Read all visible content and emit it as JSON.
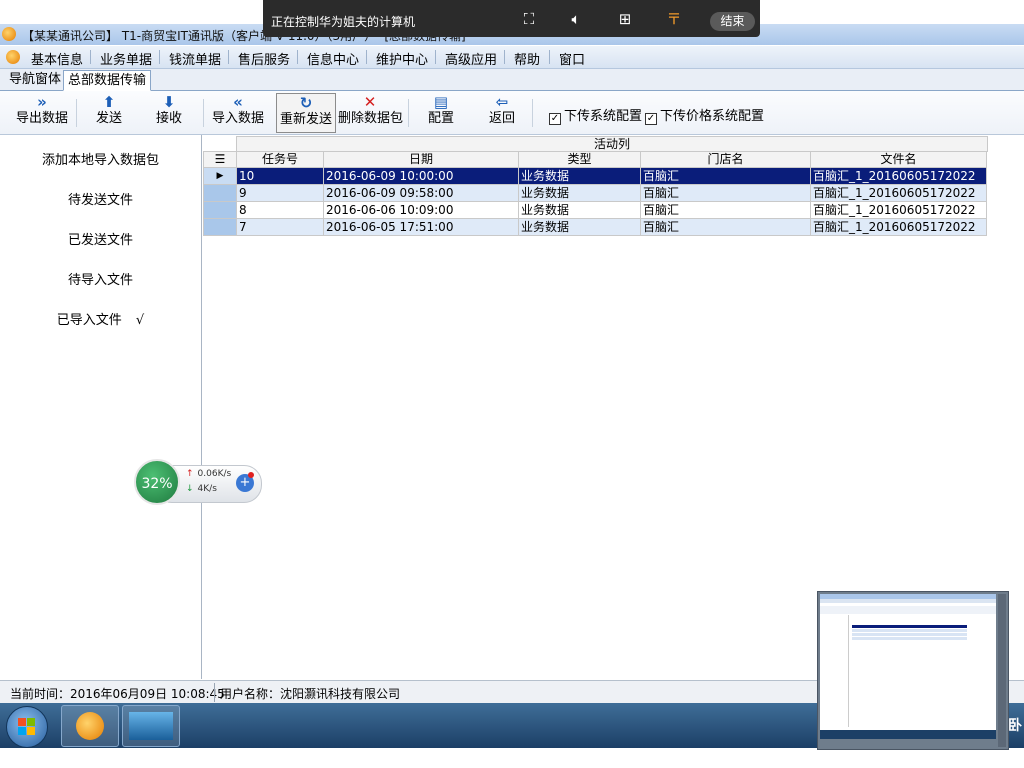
{
  "remote_bar": {
    "text": "正在控制华为姐夫的计算机",
    "end_label": "结束"
  },
  "window": {
    "title": "【某某通讯公司】 T1-商贸宝IT通讯版（客户端 V 11.0）（3用户）- [总部数据传输]"
  },
  "menu": [
    "基本信息",
    "业务单据",
    "钱流单据",
    "售后服务",
    "信息中心",
    "维护中心",
    "高级应用",
    "帮助",
    "窗口"
  ],
  "tabs": [
    "导航窗体",
    "总部数据传输"
  ],
  "toolbar": {
    "export_data": "导出数据",
    "send": "发送",
    "receive": "接收",
    "import_data": "导入数据",
    "resend": "重新发送",
    "delete_package": "删除数据包",
    "config": "配置",
    "back": "返回",
    "chk_system_config": "下传系统配置",
    "chk_price_config": "下传价格系统配置"
  },
  "left_nav": {
    "add_local": "添加本地导入数据包",
    "pending_send": "待发送文件",
    "sent": "已发送文件",
    "pending_import": "待导入文件",
    "imported": "已导入文件",
    "imported_mark": "√"
  },
  "grid": {
    "group_header": "活动列",
    "columns": [
      "任务号",
      "日期",
      "类型",
      "门店名",
      "文件名"
    ],
    "rows": [
      {
        "task": "10",
        "date": "2016-06-09 10:00:00",
        "type": "业务数据",
        "store": "百脑汇",
        "file": "百脑汇_1_20160605172022"
      },
      {
        "task": "9",
        "date": "2016-06-09 09:58:00",
        "type": "业务数据",
        "store": "百脑汇",
        "file": "百脑汇_1_20160605172022"
      },
      {
        "task": "8",
        "date": "2016-06-06 10:09:00",
        "type": "业务数据",
        "store": "百脑汇",
        "file": "百脑汇_1_20160605172022"
      },
      {
        "task": "7",
        "date": "2016-06-05 17:51:00",
        "type": "业务数据",
        "store": "百脑汇",
        "file": "百脑汇_1_20160605172022"
      }
    ]
  },
  "net_widget": {
    "percent": "32%",
    "up": "0.06K/s",
    "down": "4K/s"
  },
  "status": {
    "time": "当前时间：2016年06月09日 10:08:45",
    "user": "用户名称：沈阳灏讯科技有限公司"
  },
  "colors": {
    "selected_row": "#0a1d7a",
    "alt_row": "#dfeaf8",
    "taskbar": "#1c3f66"
  }
}
